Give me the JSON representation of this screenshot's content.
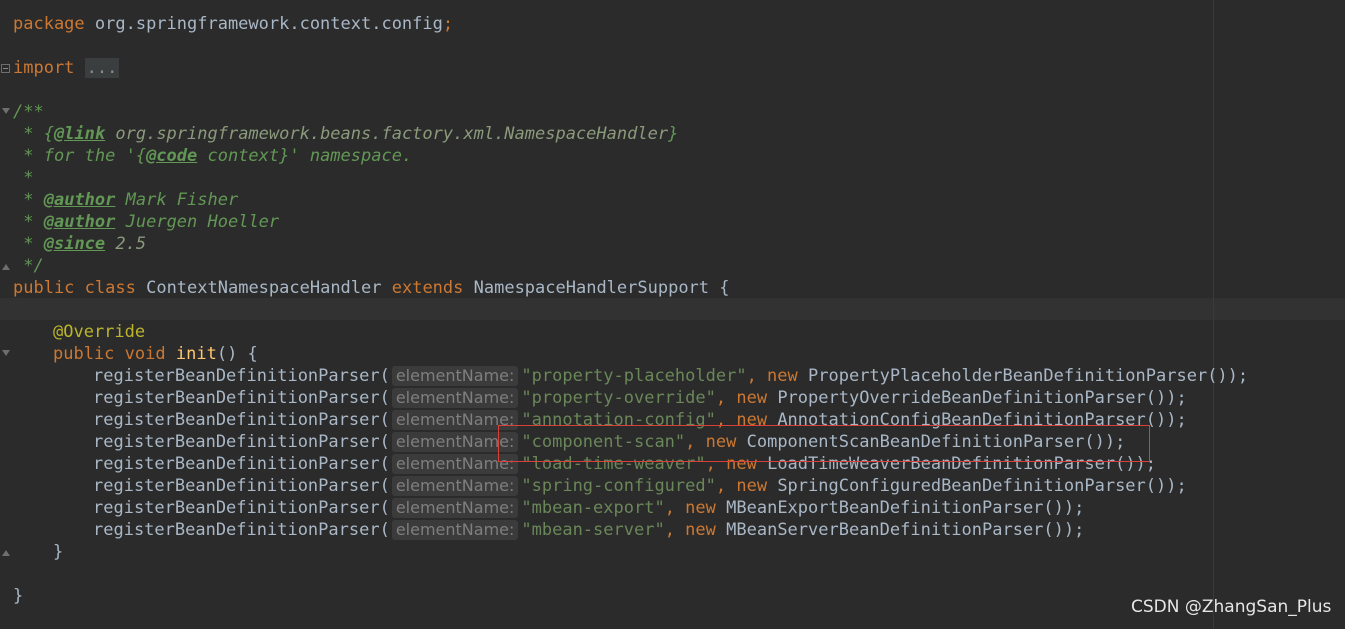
{
  "code": {
    "package_kw": "package",
    "package_name": " org.springframework.context.config",
    "semicolon": ";",
    "import_kw": "import",
    "import_dots": "...",
    "doc_open": "/**",
    "doc_line1_star": " * {",
    "doc_link_tag": "@link",
    "doc_link_target": " org.springframework.beans.factory.xml.NamespaceHandler",
    "doc_link_close": "}",
    "doc_line2_a": " * for the '{",
    "doc_code_tag": "@code",
    "doc_line2_b": " context}' namespace.",
    "doc_star": " *",
    "doc_author_tag": "@author",
    "doc_author1": " Mark Fisher",
    "doc_author2": " Juergen Hoeller",
    "doc_since_tag": "@since",
    "doc_since_value": " 2.5",
    "doc_close": " */",
    "class_public": "public",
    "class_kw": "class",
    "class_name": " ContextNamespaceHandler ",
    "extends_kw": "extends",
    "super_name": " NamespaceHandlerSupport {",
    "override_ann": "@Override",
    "method_public": "public",
    "method_void": "void",
    "method_name": "init",
    "method_sig": "() {",
    "call_name": "registerBeanDefinitionParser(",
    "param_hint": "elementName:",
    "new_kw": "new",
    "call_close": "());",
    "calls": [
      {
        "element": "\"property-placeholder\"",
        "parser": "PropertyPlaceholderBeanDefinitionParser"
      },
      {
        "element": "\"property-override\"",
        "parser": "PropertyOverrideBeanDefinitionParser"
      },
      {
        "element": "\"annotation-config\"",
        "parser": "AnnotationConfigBeanDefinitionParser"
      },
      {
        "element": "\"component-scan\"",
        "parser": "ComponentScanBeanDefinitionParser"
      },
      {
        "element": "\"load-time-weaver\"",
        "parser": "LoadTimeWeaverBeanDefinitionParser"
      },
      {
        "element": "\"spring-configured\"",
        "parser": "SpringConfiguredBeanDefinitionParser"
      },
      {
        "element": "\"mbean-export\"",
        "parser": "MBeanExportBeanDefinitionParser"
      },
      {
        "element": "\"mbean-server\"",
        "parser": "MBeanServerBeanDefinitionParser"
      }
    ],
    "method_close": "}",
    "class_close": "}"
  },
  "watermark": "CSDN @ZhangSan_Plus",
  "colors": {
    "background": "#2b2b2b",
    "keyword": "#cc7832",
    "string": "#6a8759",
    "annotation": "#bbb529",
    "method": "#ffc66d",
    "doc_comment": "#629755",
    "highlight_box": "#d9403a"
  }
}
